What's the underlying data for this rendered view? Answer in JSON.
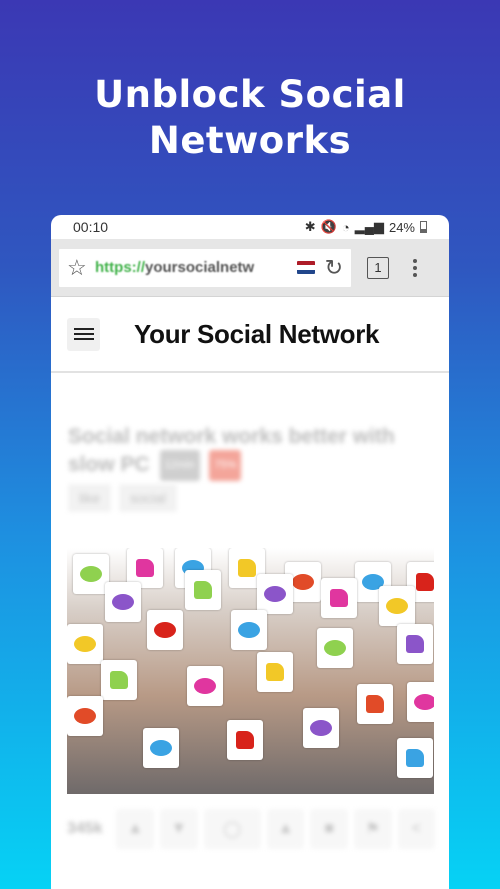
{
  "promo": {
    "headline_line1": "Unblock Social",
    "headline_line2": "Networks",
    "gradient_top": "#3b38b4",
    "gradient_bottom": "#06d2f5"
  },
  "statusbar": {
    "time": "00:10",
    "icons": [
      "bluetooth-icon",
      "mute-vibrate-icon",
      "wifi-icon",
      "signal-icon",
      "battery-icon"
    ],
    "battery": "24%"
  },
  "browser": {
    "url_scheme": "https://",
    "url_host": "yoursocialnetw",
    "url_scheme_color": "#41b24a",
    "flag_colors": [
      "#ae1c28",
      "#ffffff",
      "#21468b"
    ],
    "tab_count": "1"
  },
  "site": {
    "title": "Your Social Network"
  },
  "post": {
    "title": "Social network works better with slow PC",
    "badge_gray": "12min",
    "badge_red": "75%",
    "tags": [
      "like",
      "social"
    ],
    "image_alt": "Crowd of people holding tablets with social icons",
    "like_count": "345k",
    "actions": [
      "like-icon",
      "dislike-icon",
      "comment-icon",
      "upload-icon",
      "bookmark-icon",
      "flag-icon",
      "share-icon"
    ]
  }
}
